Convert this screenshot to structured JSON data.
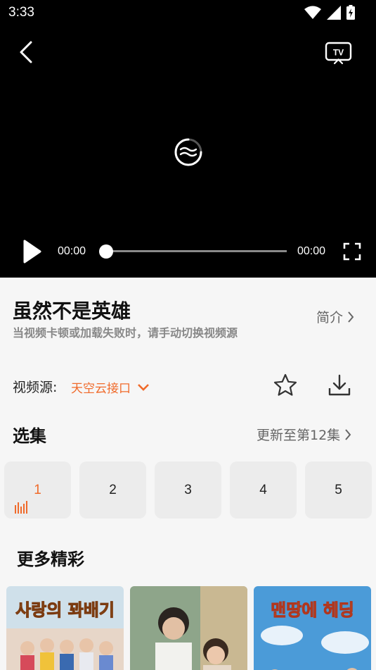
{
  "status_bar": {
    "time": "3:33"
  },
  "player": {
    "current_time": "00:00",
    "total_time": "00:00",
    "progress": 0
  },
  "info": {
    "title": "虽然不是英雄",
    "intro_label": "简介",
    "tip": "当视频卡顿或加载失败时，请手动切换视频源",
    "source_label": "视频源:",
    "source_value": "天空云接口"
  },
  "episodes": {
    "heading": "选集",
    "update_label": "更新至第12集",
    "items": [
      "1",
      "2",
      "3",
      "4",
      "5"
    ],
    "active_index": 0
  },
  "more": {
    "heading": "更多精彩",
    "posters": [
      {
        "title": "사랑의 꽈배기",
        "bg": "#c9d9e6",
        "accent": "#e8a23a"
      },
      {
        "title": "",
        "bg": "#8fa78a",
        "accent": "#d8c9a8"
      },
      {
        "title": "맨땅에 헤딩",
        "bg": "#4a9ad6",
        "accent": "#f2d23a"
      }
    ]
  },
  "colors": {
    "accent": "#f06a2a",
    "background": "#f6f6f6",
    "player_bg": "#000000"
  }
}
